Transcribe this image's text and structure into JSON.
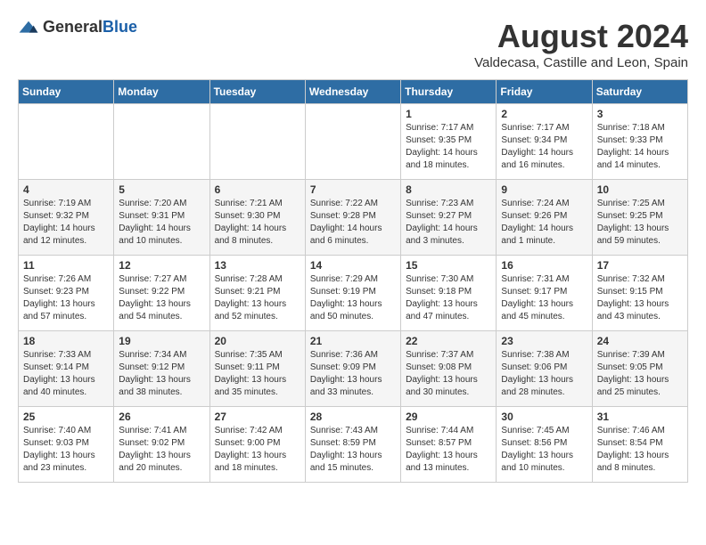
{
  "header": {
    "logo_general": "General",
    "logo_blue": "Blue",
    "month_title": "August 2024",
    "subtitle": "Valdecasa, Castille and Leon, Spain"
  },
  "days_of_week": [
    "Sunday",
    "Monday",
    "Tuesday",
    "Wednesday",
    "Thursday",
    "Friday",
    "Saturday"
  ],
  "weeks": [
    [
      {
        "day": "",
        "content": ""
      },
      {
        "day": "",
        "content": ""
      },
      {
        "day": "",
        "content": ""
      },
      {
        "day": "",
        "content": ""
      },
      {
        "day": "1",
        "content": "Sunrise: 7:17 AM\nSunset: 9:35 PM\nDaylight: 14 hours\nand 18 minutes."
      },
      {
        "day": "2",
        "content": "Sunrise: 7:17 AM\nSunset: 9:34 PM\nDaylight: 14 hours\nand 16 minutes."
      },
      {
        "day": "3",
        "content": "Sunrise: 7:18 AM\nSunset: 9:33 PM\nDaylight: 14 hours\nand 14 minutes."
      }
    ],
    [
      {
        "day": "4",
        "content": "Sunrise: 7:19 AM\nSunset: 9:32 PM\nDaylight: 14 hours\nand 12 minutes."
      },
      {
        "day": "5",
        "content": "Sunrise: 7:20 AM\nSunset: 9:31 PM\nDaylight: 14 hours\nand 10 minutes."
      },
      {
        "day": "6",
        "content": "Sunrise: 7:21 AM\nSunset: 9:30 PM\nDaylight: 14 hours\nand 8 minutes."
      },
      {
        "day": "7",
        "content": "Sunrise: 7:22 AM\nSunset: 9:28 PM\nDaylight: 14 hours\nand 6 minutes."
      },
      {
        "day": "8",
        "content": "Sunrise: 7:23 AM\nSunset: 9:27 PM\nDaylight: 14 hours\nand 3 minutes."
      },
      {
        "day": "9",
        "content": "Sunrise: 7:24 AM\nSunset: 9:26 PM\nDaylight: 14 hours\nand 1 minute."
      },
      {
        "day": "10",
        "content": "Sunrise: 7:25 AM\nSunset: 9:25 PM\nDaylight: 13 hours\nand 59 minutes."
      }
    ],
    [
      {
        "day": "11",
        "content": "Sunrise: 7:26 AM\nSunset: 9:23 PM\nDaylight: 13 hours\nand 57 minutes."
      },
      {
        "day": "12",
        "content": "Sunrise: 7:27 AM\nSunset: 9:22 PM\nDaylight: 13 hours\nand 54 minutes."
      },
      {
        "day": "13",
        "content": "Sunrise: 7:28 AM\nSunset: 9:21 PM\nDaylight: 13 hours\nand 52 minutes."
      },
      {
        "day": "14",
        "content": "Sunrise: 7:29 AM\nSunset: 9:19 PM\nDaylight: 13 hours\nand 50 minutes."
      },
      {
        "day": "15",
        "content": "Sunrise: 7:30 AM\nSunset: 9:18 PM\nDaylight: 13 hours\nand 47 minutes."
      },
      {
        "day": "16",
        "content": "Sunrise: 7:31 AM\nSunset: 9:17 PM\nDaylight: 13 hours\nand 45 minutes."
      },
      {
        "day": "17",
        "content": "Sunrise: 7:32 AM\nSunset: 9:15 PM\nDaylight: 13 hours\nand 43 minutes."
      }
    ],
    [
      {
        "day": "18",
        "content": "Sunrise: 7:33 AM\nSunset: 9:14 PM\nDaylight: 13 hours\nand 40 minutes."
      },
      {
        "day": "19",
        "content": "Sunrise: 7:34 AM\nSunset: 9:12 PM\nDaylight: 13 hours\nand 38 minutes."
      },
      {
        "day": "20",
        "content": "Sunrise: 7:35 AM\nSunset: 9:11 PM\nDaylight: 13 hours\nand 35 minutes."
      },
      {
        "day": "21",
        "content": "Sunrise: 7:36 AM\nSunset: 9:09 PM\nDaylight: 13 hours\nand 33 minutes."
      },
      {
        "day": "22",
        "content": "Sunrise: 7:37 AM\nSunset: 9:08 PM\nDaylight: 13 hours\nand 30 minutes."
      },
      {
        "day": "23",
        "content": "Sunrise: 7:38 AM\nSunset: 9:06 PM\nDaylight: 13 hours\nand 28 minutes."
      },
      {
        "day": "24",
        "content": "Sunrise: 7:39 AM\nSunset: 9:05 PM\nDaylight: 13 hours\nand 25 minutes."
      }
    ],
    [
      {
        "day": "25",
        "content": "Sunrise: 7:40 AM\nSunset: 9:03 PM\nDaylight: 13 hours\nand 23 minutes."
      },
      {
        "day": "26",
        "content": "Sunrise: 7:41 AM\nSunset: 9:02 PM\nDaylight: 13 hours\nand 20 minutes."
      },
      {
        "day": "27",
        "content": "Sunrise: 7:42 AM\nSunset: 9:00 PM\nDaylight: 13 hours\nand 18 minutes."
      },
      {
        "day": "28",
        "content": "Sunrise: 7:43 AM\nSunset: 8:59 PM\nDaylight: 13 hours\nand 15 minutes."
      },
      {
        "day": "29",
        "content": "Sunrise: 7:44 AM\nSunset: 8:57 PM\nDaylight: 13 hours\nand 13 minutes."
      },
      {
        "day": "30",
        "content": "Sunrise: 7:45 AM\nSunset: 8:56 PM\nDaylight: 13 hours\nand 10 minutes."
      },
      {
        "day": "31",
        "content": "Sunrise: 7:46 AM\nSunset: 8:54 PM\nDaylight: 13 hours\nand 8 minutes."
      }
    ]
  ]
}
